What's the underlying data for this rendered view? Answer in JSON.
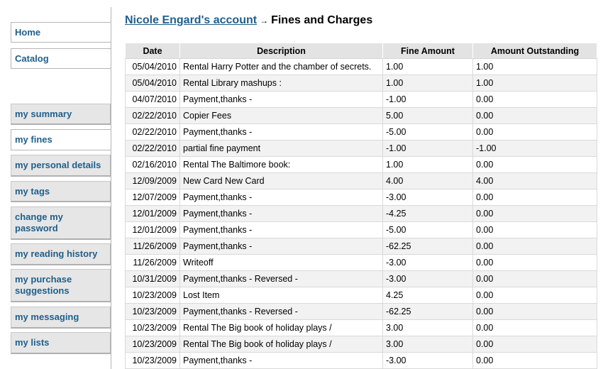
{
  "nav": {
    "home": "Home",
    "catalog": "Catalog",
    "items": [
      {
        "label": "my summary"
      },
      {
        "label": "my fines"
      },
      {
        "label": "my personal details"
      },
      {
        "label": "my tags"
      },
      {
        "label": "change my password"
      },
      {
        "label": "my reading history"
      },
      {
        "label": "my purchase suggestions"
      },
      {
        "label": "my messaging"
      },
      {
        "label": "my lists"
      }
    ]
  },
  "header": {
    "account_link": "Nicole Engard's account",
    "separator": "→",
    "page_title": "Fines and Charges"
  },
  "table": {
    "columns": [
      "Date",
      "Description",
      "Fine Amount",
      "Amount Outstanding"
    ],
    "rows": [
      {
        "date": "05/04/2010",
        "description": "Rental Harry Potter and the chamber of secrets.",
        "fine": "1.00",
        "outstanding": "1.00"
      },
      {
        "date": "05/04/2010",
        "description": "Rental Library mashups :",
        "fine": "1.00",
        "outstanding": "1.00"
      },
      {
        "date": "04/07/2010",
        "description": "Payment,thanks -",
        "fine": "-1.00",
        "outstanding": "0.00"
      },
      {
        "date": "02/22/2010",
        "description": "Copier Fees",
        "fine": "5.00",
        "outstanding": "0.00"
      },
      {
        "date": "02/22/2010",
        "description": "Payment,thanks -",
        "fine": "-5.00",
        "outstanding": "0.00"
      },
      {
        "date": "02/22/2010",
        "description": "partial fine payment",
        "fine": "-1.00",
        "outstanding": "-1.00"
      },
      {
        "date": "02/16/2010",
        "description": "Rental The Baltimore book:",
        "fine": "1.00",
        "outstanding": "0.00"
      },
      {
        "date": "12/09/2009",
        "description": "New Card New Card",
        "fine": "4.00",
        "outstanding": "4.00"
      },
      {
        "date": "12/07/2009",
        "description": "Payment,thanks -",
        "fine": "-3.00",
        "outstanding": "0.00"
      },
      {
        "date": "12/01/2009",
        "description": "Payment,thanks -",
        "fine": "-4.25",
        "outstanding": "0.00"
      },
      {
        "date": "12/01/2009",
        "description": "Payment,thanks -",
        "fine": "-5.00",
        "outstanding": "0.00"
      },
      {
        "date": "11/26/2009",
        "description": "Payment,thanks -",
        "fine": "-62.25",
        "outstanding": "0.00"
      },
      {
        "date": "11/26/2009",
        "description": "Writeoff",
        "fine": "-3.00",
        "outstanding": "0.00"
      },
      {
        "date": "10/31/2009",
        "description": "Payment,thanks - Reversed -",
        "fine": "-3.00",
        "outstanding": "0.00"
      },
      {
        "date": "10/23/2009",
        "description": "Lost Item",
        "fine": "4.25",
        "outstanding": "0.00"
      },
      {
        "date": "10/23/2009",
        "description": "Payment,thanks - Reversed -",
        "fine": "-62.25",
        "outstanding": "0.00"
      },
      {
        "date": "10/23/2009",
        "description": "Rental The Big book of holiday plays /",
        "fine": "3.00",
        "outstanding": "0.00"
      },
      {
        "date": "10/23/2009",
        "description": "Rental The Big book of holiday plays /",
        "fine": "3.00",
        "outstanding": "0.00"
      },
      {
        "date": "10/23/2009",
        "description": "Payment,thanks -",
        "fine": "-3.00",
        "outstanding": "0.00"
      }
    ]
  }
}
